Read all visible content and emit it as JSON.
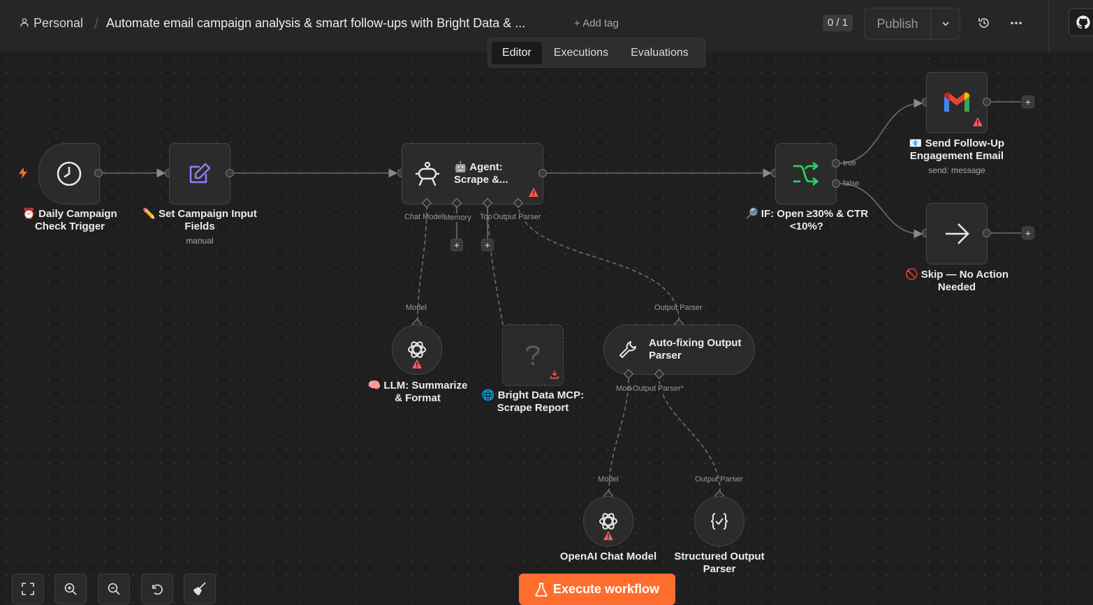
{
  "header": {
    "project": "Personal",
    "separator": "/",
    "title": "Automate email campaign analysis & smart follow-ups with Bright Data & ...",
    "add_tag": "+ Add tag",
    "counter": "0 / 1",
    "publish_label": "Publish"
  },
  "tabs": [
    {
      "label": "Editor",
      "active": true
    },
    {
      "label": "Executions",
      "active": false
    },
    {
      "label": "Evaluations",
      "active": false
    }
  ],
  "nodes": {
    "trigger": {
      "label1": "⏰ Daily Campaign",
      "label2": "Check Trigger"
    },
    "set_fields": {
      "label1": "✏️ Set Campaign Input",
      "label2": "Fields",
      "sub": "manual"
    },
    "agent": {
      "line1": "🤖 Agent:",
      "line2": "Scrape &..."
    },
    "if_node": {
      "label1": "🔎 IF: Open ≥30% & CTR",
      "label2": "<10%?",
      "true_label": "true",
      "false_label": "false"
    },
    "gmail": {
      "label1": "📧 Send Follow-Up",
      "label2": "Engagement Email",
      "sub": "send: message"
    },
    "skip": {
      "label1": "🚫 Skip — No Action",
      "label2": "Needed"
    },
    "llm": {
      "label1": "🧠 LLM: Summarize",
      "label2": "& Format"
    },
    "bright_data": {
      "label1": "🌐 Bright Data MCP:",
      "label2": "Scrape Report"
    },
    "autofix": {
      "line1": "Auto-fixing Output",
      "line2": "Parser"
    },
    "openai": {
      "label": "OpenAI Chat Model"
    },
    "structured": {
      "label1": "Structured Output",
      "label2": "Parser"
    }
  },
  "ports": {
    "agent_chat_model": "Chat Model",
    "agent_memory": "Memory",
    "agent_tool": "Tool",
    "agent_output_parser": "Output Parser",
    "llm_model": "Model",
    "autofix_output_parser_in": "Output Parser",
    "autofix_model": "Model",
    "autofix_output_parser": "Output Parser",
    "autofix_required": "*",
    "openai_model": "Model",
    "structured_output_parser": "Output Parser"
  },
  "footer": {
    "execute_label": "Execute workflow"
  },
  "colors": {
    "accent": "#ff6d2d",
    "if_icon": "#2bd15f",
    "set_icon": "#8b83f5",
    "warning": "#ff5a5a"
  }
}
